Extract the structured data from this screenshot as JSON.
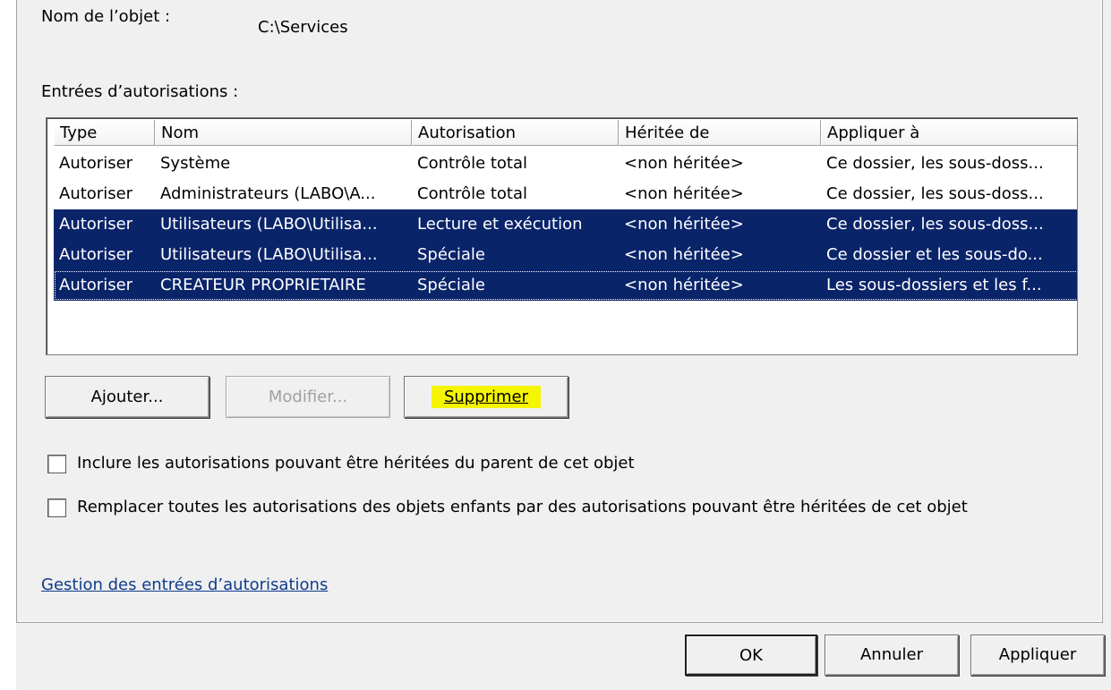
{
  "object": {
    "label": "Nom de l’objet :",
    "value": "C:\\Services"
  },
  "entries_label": "Entrées d’autorisations :",
  "table": {
    "columns": [
      "Type",
      "Nom",
      "Autorisation",
      "Héritée de",
      "Appliquer à"
    ],
    "rows": [
      {
        "type": "Autoriser",
        "name": "Système",
        "permission": "Contrôle total",
        "inherited": "<non héritée>",
        "apply": "Ce dossier, les sous-doss...",
        "selected": false
      },
      {
        "type": "Autoriser",
        "name": "Administrateurs (LABO\\A...",
        "permission": "Contrôle total",
        "inherited": "<non héritée>",
        "apply": "Ce dossier, les sous-doss...",
        "selected": false
      },
      {
        "type": "Autoriser",
        "name": "Utilisateurs (LABO\\Utilisa...",
        "permission": "Lecture et exécution",
        "inherited": "<non héritée>",
        "apply": "Ce dossier, les sous-doss...",
        "selected": true
      },
      {
        "type": "Autoriser",
        "name": "Utilisateurs (LABO\\Utilisa...",
        "permission": "Spéciale",
        "inherited": "<non héritée>",
        "apply": "Ce dossier et les sous-do...",
        "selected": true
      },
      {
        "type": "Autoriser",
        "name": "CREATEUR PROPRIETAIRE",
        "permission": "Spéciale",
        "inherited": "<non héritée>",
        "apply": "Les sous-dossiers et les f...",
        "selected": true
      }
    ]
  },
  "buttons": {
    "add": "Ajouter...",
    "modify": "Modifier...",
    "remove": "Supprimer",
    "ok": "OK",
    "cancel": "Annuler",
    "apply": "Appliquer"
  },
  "checkboxes": {
    "include_inherited": {
      "label": "Inclure les autorisations pouvant être héritées du parent de cet objet",
      "checked": false
    },
    "replace_children": {
      "label": "Remplacer toutes les autorisations des objets enfants par des autorisations pouvant être héritées de cet objet",
      "checked": false
    }
  },
  "link": "Gestion des entrées d’autorisations",
  "colors": {
    "selection": "#0a246a",
    "highlight": "#f5f500",
    "link": "#0f3c8c"
  }
}
